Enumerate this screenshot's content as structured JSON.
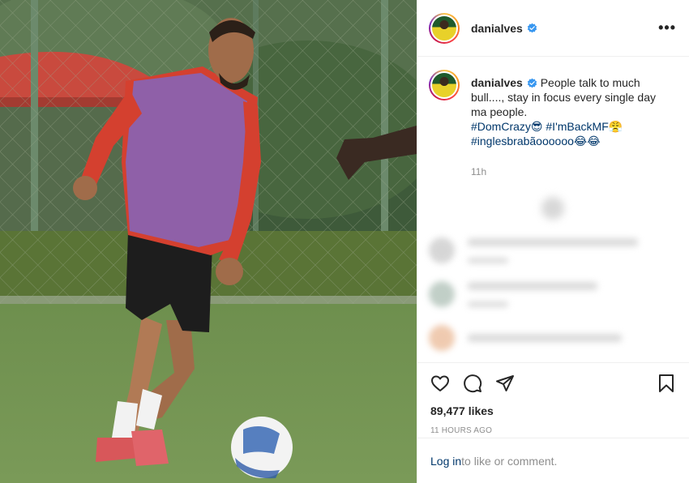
{
  "post": {
    "username": "danialves",
    "more_label": "•••",
    "caption_text": "People talk to much bull...., stay in focus every single day ma people.",
    "hashtags": [
      "#DomCrazy😎",
      "#I'mBackMF😤",
      "#inglesbrabãoooooo😂😂"
    ],
    "time_short": "11h",
    "likes": "89,477 likes",
    "time_ago": "11 HOURS AGO",
    "login_link": "Log in",
    "login_suffix": " to like or comment."
  },
  "icons": {
    "header": [
      "verified-badge-icon",
      "more-options-icon"
    ],
    "actions": [
      "heart-icon",
      "comment-icon",
      "share-icon",
      "bookmark-icon"
    ]
  },
  "colors": {
    "link": "#00376b",
    "muted": "#8e8e8e",
    "verified": "#3897f0"
  }
}
